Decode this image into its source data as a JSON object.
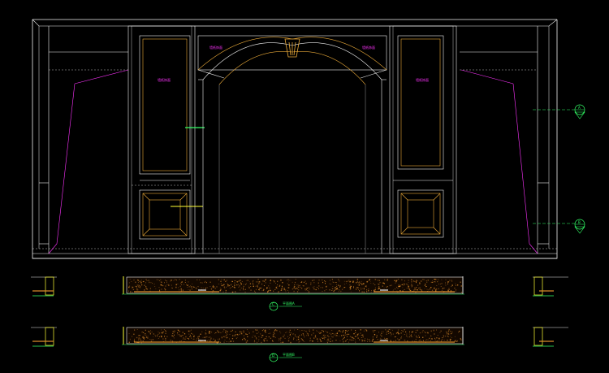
{
  "drawing": {
    "background": "#000000",
    "colors": {
      "frame": "#f2f2f2",
      "wood": "#e8a838",
      "dim": "#ff33ff",
      "section": "#33ff66",
      "hatch": "#d98a2a",
      "grey": "#9a9a9a",
      "yellow": "#ffff33",
      "cyan": "#33cccc"
    },
    "labels": {
      "panel_left_tall": "墙纸饰面",
      "panel_right_tall": "墙纸饰面",
      "arch_left": "墙纸饰面",
      "arch_right": "墙纸饰面",
      "plan_a": "平面图A",
      "plan_b": "平面图B",
      "marker_a": "A",
      "marker_b": "B",
      "marker_c": "C",
      "marker_d": "D"
    },
    "icons": [
      "arch-keystone-icon",
      "section-marker-icon"
    ]
  }
}
